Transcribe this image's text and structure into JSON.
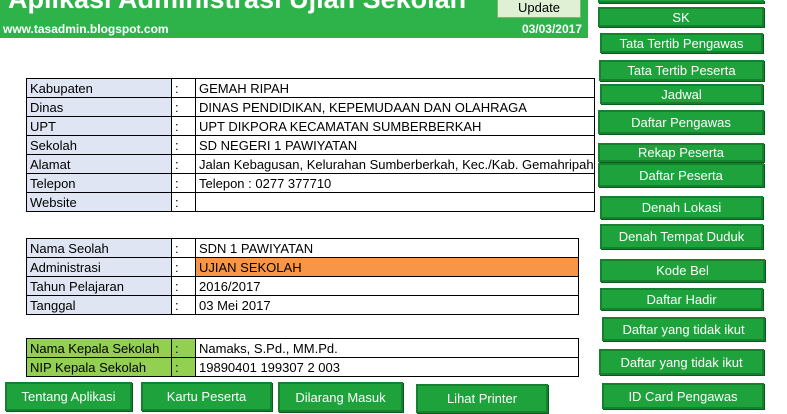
{
  "header": {
    "title": "Aplikasi Administrasi Ujian Sekolah",
    "site_url": "www.tasadmin.blogspot.com",
    "date": "03/03/2017",
    "update_label": "Update"
  },
  "colon": ":",
  "school_info": [
    {
      "label": "Kabupaten",
      "value": "GEMAH RIPAH"
    },
    {
      "label": "Dinas",
      "value": "DINAS PENDIDIKAN, KEPEMUDAAN DAN OLAHRAGA"
    },
    {
      "label": "UPT",
      "value": "UPT DIKPORA KECAMATAN SUMBERBERKAH"
    },
    {
      "label": "Sekolah",
      "value": "SD NEGERI 1 PAWIYATAN"
    },
    {
      "label": "Alamat",
      "value": "Jalan Kebagusan, Kelurahan Sumberberkah, Kec./Kab. Gemahripah"
    },
    {
      "label": "Telepon",
      "value": "Telepon : 0277 377710"
    },
    {
      "label": "Website",
      "value": ""
    }
  ],
  "exam_info": [
    {
      "label": "Nama Seolah",
      "value": "SDN 1 PAWIYATAN"
    },
    {
      "label": "Administrasi",
      "value": "UJIAN SEKOLAH"
    },
    {
      "label": "Tahun Pelajaran",
      "value": "2016/2017"
    },
    {
      "label": "Tanggal",
      "value": "03 Mei 2017"
    }
  ],
  "principal_info": [
    {
      "label": "Nama Kepala Sekolah",
      "value": "Namaks, S.Pd., MM.Pd."
    },
    {
      "label": "NIP Kepala Sekolah",
      "value": "19890401 199307 2 003"
    }
  ],
  "side_menu": [
    "SK",
    "Tata Tertib Pengawas",
    "Tata Tertib Peserta",
    "Jadwal",
    "Daftar Pengawas",
    "Rekap Peserta",
    "Daftar Peserta",
    "Denah Lokasi",
    "Denah Tempat Duduk",
    "Kode Bel",
    "Daftar Hadir",
    "Daftar yang tidak ikut",
    "Daftar yang tidak ikut",
    "ID Card Pengawas"
  ],
  "bottom_menu": [
    "Tentang Aplikasi",
    "Kartu Peserta",
    "Dilarang Masuk",
    "Lihat Printer"
  ],
  "colors": {
    "button_green": "#1ea33c",
    "header_green": "#2db34a",
    "label_blue": "#dfe5f3",
    "highlight_orange": "#f79646",
    "principal_green": "#93cf50"
  }
}
